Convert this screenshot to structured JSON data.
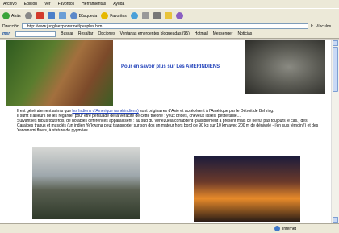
{
  "menu": [
    "Archivo",
    "Edición",
    "Ver",
    "Favoritos",
    "Herramientas",
    "Ayuda"
  ],
  "toolbar": {
    "back": "Atrás",
    "search": "Búsqueda",
    "favorites": "Favoritos"
  },
  "address": {
    "label": "Dirección",
    "url": "http://www.jungleexplorer.net/peuples.htm",
    "go_label": "Ir",
    "links_label": "Vínculos"
  },
  "msnbar": {
    "logo": "msn",
    "search_btn": "Buscar",
    "highlight": "Resaltar",
    "options": "Opciones",
    "popups": "Ventanas emergentes bloqueadas (95)",
    "hotmail": "Hotmail",
    "messenger": "Messenger",
    "news": "Noticias"
  },
  "content": {
    "more_link": "Pour en savoir plus sur Les AMERINDIENS",
    "p1_pre": "Il est généralement admis que ",
    "p1_link": "les Indiens d'Amérique (amérindiens)",
    "p1_post": " sont originaires d'Asie et accédèrent à l'Amérique par le Détroit de Behring.",
    "p2": "Il suffit d'ailleurs de les regarder pour être persuadé de la véracité de cette théorie : yeux bridés, cheveux lisses, petite taille...",
    "p3": "Suivant les tribus toutefois, de notables différences apparaissent : au sud du Venezuela cohabitent (paisiblement à présent mais ce ne fut pas toujours le cas.) des Caraïbes trapus et musclés (un indien Ye'kwana peut transporter sur son dos un mateur hors bord de 90 kg sur 10 km avec 200 m de dénivelé - j'en suis témoin !) et des Yanomami fluets, à stature de pygmées..."
  },
  "status": {
    "zone": "Internet"
  }
}
